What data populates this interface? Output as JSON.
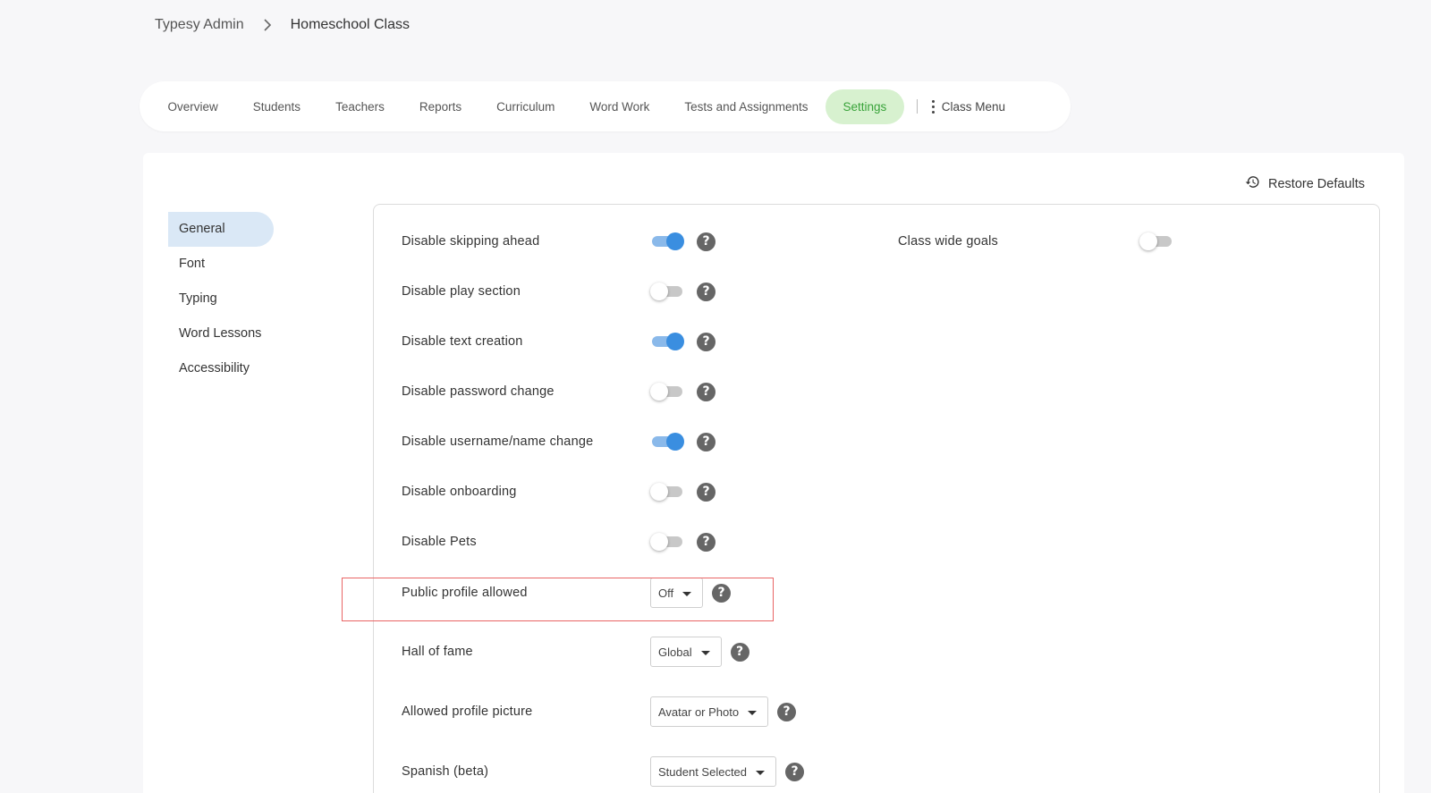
{
  "breadcrumb": {
    "root": "Typesy Admin",
    "current": "Homeschool Class"
  },
  "tabs": [
    {
      "label": "Overview"
    },
    {
      "label": "Students"
    },
    {
      "label": "Teachers"
    },
    {
      "label": "Reports"
    },
    {
      "label": "Curriculum"
    },
    {
      "label": "Word Work"
    },
    {
      "label": "Tests and Assignments"
    },
    {
      "label": "Settings",
      "active": true
    }
  ],
  "class_menu": {
    "label": "Class Menu"
  },
  "restore": {
    "label": "Restore Defaults"
  },
  "side_nav": [
    {
      "label": "General",
      "active": true
    },
    {
      "label": "Font"
    },
    {
      "label": "Typing"
    },
    {
      "label": "Word Lessons"
    },
    {
      "label": "Accessibility"
    }
  ],
  "settings": {
    "toggles": [
      {
        "label": "Disable skipping ahead",
        "on": true
      },
      {
        "label": "Disable play section",
        "on": false
      },
      {
        "label": "Disable text creation",
        "on": true
      },
      {
        "label": "Disable password change",
        "on": false
      },
      {
        "label": "Disable username/name change",
        "on": true
      },
      {
        "label": "Disable onboarding",
        "on": false
      },
      {
        "label": "Disable Pets",
        "on": false
      }
    ],
    "class_wide_goals": {
      "label": "Class wide goals",
      "on": false
    },
    "selects": [
      {
        "label": "Public profile allowed",
        "value": "Off"
      },
      {
        "label": "Hall of fame",
        "value": "Global"
      },
      {
        "label": "Allowed profile picture",
        "value": "Avatar or Photo"
      },
      {
        "label": "Spanish (beta)",
        "value": "Student Selected"
      }
    ],
    "help_glyph": "?"
  },
  "colors": {
    "accent_blue": "#3a8ee0",
    "active_tab_bg": "#d7f1cf",
    "active_tab_text": "#39a33a",
    "active_side_bg": "#dae8f6",
    "highlight_border": "#e96565"
  }
}
